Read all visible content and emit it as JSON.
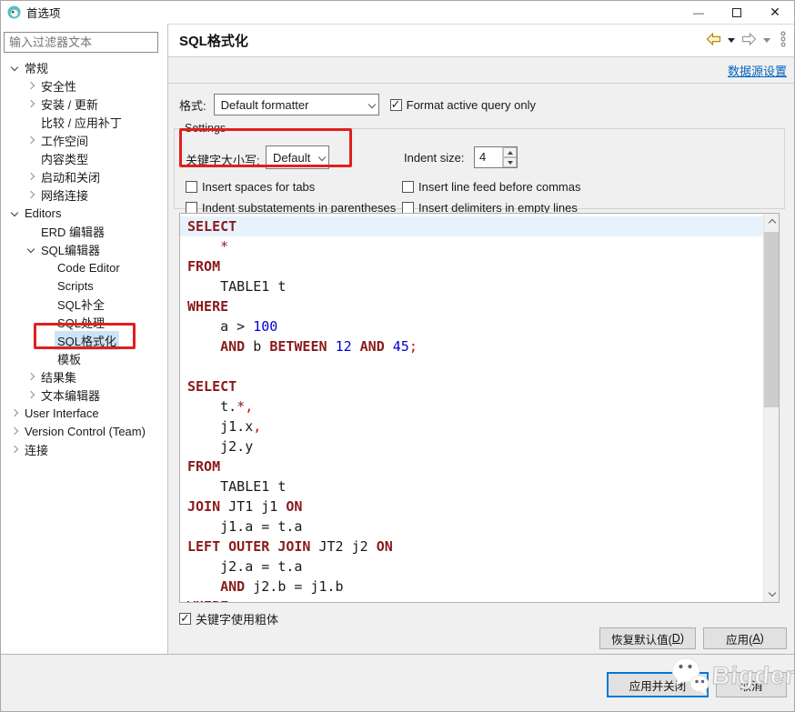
{
  "window": {
    "title": "首选项",
    "controls": {
      "minimize": "—",
      "close": "✕"
    }
  },
  "sidebar": {
    "filter_placeholder": "输入过滤器文本",
    "tree": [
      {
        "label": "常规",
        "indent": 0,
        "state": "open"
      },
      {
        "label": "安全性",
        "indent": 1,
        "state": "closed"
      },
      {
        "label": "安装 / 更新",
        "indent": 1,
        "state": "closed"
      },
      {
        "label": "比较 / 应用补丁",
        "indent": 1,
        "state": "leaf"
      },
      {
        "label": "工作空间",
        "indent": 1,
        "state": "closed"
      },
      {
        "label": "内容类型",
        "indent": 1,
        "state": "leaf"
      },
      {
        "label": "启动和关闭",
        "indent": 1,
        "state": "closed"
      },
      {
        "label": "网络连接",
        "indent": 1,
        "state": "closed"
      },
      {
        "label": "Editors",
        "indent": 0,
        "state": "open"
      },
      {
        "label": "ERD 编辑器",
        "indent": 1,
        "state": "leaf"
      },
      {
        "label": "SQL编辑器",
        "indent": 1,
        "state": "open"
      },
      {
        "label": "Code Editor",
        "indent": 2,
        "state": "leaf"
      },
      {
        "label": "Scripts",
        "indent": 2,
        "state": "leaf"
      },
      {
        "label": "SQL补全",
        "indent": 2,
        "state": "leaf"
      },
      {
        "label": "SQL处理",
        "indent": 2,
        "state": "leaf"
      },
      {
        "label": "SQL格式化",
        "indent": 2,
        "state": "leaf",
        "selected": true
      },
      {
        "label": "模板",
        "indent": 2,
        "state": "leaf"
      },
      {
        "label": "结果集",
        "indent": 1,
        "state": "closed"
      },
      {
        "label": "文本编辑器",
        "indent": 1,
        "state": "closed"
      },
      {
        "label": "User Interface",
        "indent": 0,
        "state": "closed"
      },
      {
        "label": "Version Control (Team)",
        "indent": 0,
        "state": "closed"
      },
      {
        "label": "连接",
        "indent": 0,
        "state": "closed"
      }
    ]
  },
  "header": {
    "title": "SQL格式化",
    "datasource_link": "数据源设置"
  },
  "format_row": {
    "label": "格式:",
    "combo_value": "Default formatter",
    "checkbox_label": "Format active query only",
    "checkbox_checked": true
  },
  "settings": {
    "legend": "Settings",
    "keyword_case_label": "关键字大小写:",
    "keyword_case_value": "Default",
    "indent_size_label": "Indent size:",
    "indent_size_value": "4",
    "checkboxes": [
      {
        "label": "Insert spaces for tabs",
        "checked": false
      },
      {
        "label": "Insert line feed before commas",
        "checked": false
      },
      {
        "label": "Indent substatements in parentheses",
        "checked": false
      },
      {
        "label": "Insert delimiters in empty lines",
        "checked": false
      }
    ]
  },
  "preview": {
    "highlight_line": 0,
    "lines": [
      [
        {
          "t": "SELECT",
          "c": "k"
        }
      ],
      [
        {
          "t": "    ",
          "c": "p"
        },
        {
          "t": "*",
          "c": "s"
        }
      ],
      [
        {
          "t": "FROM",
          "c": "k"
        }
      ],
      [
        {
          "t": "    TABLE1 t",
          "c": "p"
        }
      ],
      [
        {
          "t": "WHERE",
          "c": "k"
        }
      ],
      [
        {
          "t": "    a > ",
          "c": "p"
        },
        {
          "t": "100",
          "c": "n"
        }
      ],
      [
        {
          "t": "    ",
          "c": "p"
        },
        {
          "t": "AND",
          "c": "k"
        },
        {
          "t": " b ",
          "c": "p"
        },
        {
          "t": "BETWEEN",
          "c": "k"
        },
        {
          "t": " ",
          "c": "p"
        },
        {
          "t": "12",
          "c": "n"
        },
        {
          "t": " ",
          "c": "p"
        },
        {
          "t": "AND",
          "c": "k"
        },
        {
          "t": " ",
          "c": "p"
        },
        {
          "t": "45",
          "c": "n"
        },
        {
          "t": ";",
          "c": "d"
        }
      ],
      [],
      [
        {
          "t": "SELECT",
          "c": "k"
        }
      ],
      [
        {
          "t": "    t.",
          "c": "p"
        },
        {
          "t": "*",
          "c": "s"
        },
        {
          "t": ",",
          "c": "d"
        }
      ],
      [
        {
          "t": "    j1.x",
          "c": "p"
        },
        {
          "t": ",",
          "c": "d"
        }
      ],
      [
        {
          "t": "    j2.y",
          "c": "p"
        }
      ],
      [
        {
          "t": "FROM",
          "c": "k"
        }
      ],
      [
        {
          "t": "    TABLE1 t",
          "c": "p"
        }
      ],
      [
        {
          "t": "JOIN",
          "c": "k"
        },
        {
          "t": " JT1 j1 ",
          "c": "p"
        },
        {
          "t": "ON",
          "c": "k"
        }
      ],
      [
        {
          "t": "    j1.a = t.a",
          "c": "p"
        }
      ],
      [
        {
          "t": "LEFT OUTER JOIN",
          "c": "k"
        },
        {
          "t": " JT2 j2 ",
          "c": "p"
        },
        {
          "t": "ON",
          "c": "k"
        }
      ],
      [
        {
          "t": "    j2.a = t.a",
          "c": "p"
        }
      ],
      [
        {
          "t": "    ",
          "c": "p"
        },
        {
          "t": "AND",
          "c": "k"
        },
        {
          "t": " j2.b = j1.b",
          "c": "p"
        }
      ],
      [
        {
          "t": "WHERE",
          "c": "k"
        }
      ]
    ]
  },
  "bold_keywords_checkbox": {
    "label": "关键字使用粗体",
    "checked": true
  },
  "action_buttons": {
    "restore_defaults": {
      "pre": "恢复默认值(",
      "key": "D",
      "post": ")"
    },
    "apply": {
      "pre": "应用(",
      "key": "A",
      "post": ")"
    }
  },
  "bottom_buttons": {
    "apply_close": "应用并关闭",
    "cancel": "取消"
  },
  "watermark": {
    "text": "Bigder"
  },
  "icons": {
    "back": "back-arrow",
    "forward": "forward-arrow",
    "view_menu": "vertical-dots"
  },
  "colors": {
    "keyword": "#8b1a1a",
    "number": "#0000d4",
    "delimiter": "#d40000",
    "annotation_red": "#e0201c",
    "line_highlight": "#e8f2fc",
    "tree_selection": "#cde4f7",
    "link": "#0563c1"
  }
}
